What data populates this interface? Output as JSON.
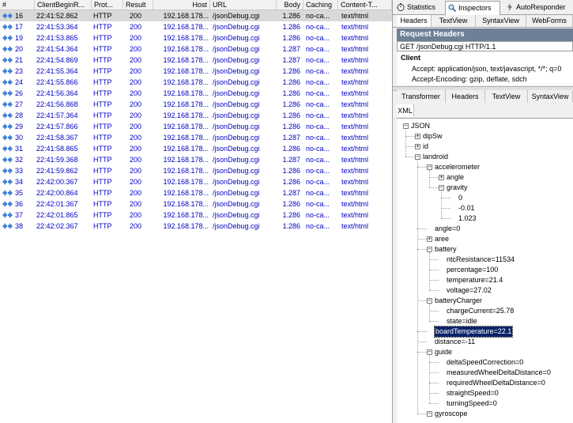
{
  "session_list": {
    "columns": [
      "#",
      "ClientBeginR...",
      "Prot...",
      "Result",
      "Host",
      "URL",
      "Body",
      "Caching",
      "Content-T..."
    ],
    "rows": [
      {
        "num": "16",
        "time": "22:41:52.862",
        "protocol": "HTTP",
        "result": "200",
        "host": "192.168.178...",
        "url": "/jsonDebug.cgi",
        "body": "1.286",
        "caching": "no-ca...",
        "ctype": "text/html",
        "selected": true
      },
      {
        "num": "17",
        "time": "22:41:53.364",
        "protocol": "HTTP",
        "result": "200",
        "host": "192.168.178...",
        "url": "/jsonDebug.cgi",
        "body": "1.286",
        "caching": "no-ca...",
        "ctype": "text/html"
      },
      {
        "num": "19",
        "time": "22:41:53.865",
        "protocol": "HTTP",
        "result": "200",
        "host": "192.168.178...",
        "url": "/jsonDebug.cgi",
        "body": "1.286",
        "caching": "no-ca...",
        "ctype": "text/html"
      },
      {
        "num": "20",
        "time": "22:41:54.364",
        "protocol": "HTTP",
        "result": "200",
        "host": "192.168.178...",
        "url": "/jsonDebug.cgi",
        "body": "1.287",
        "caching": "no-ca...",
        "ctype": "text/html"
      },
      {
        "num": "21",
        "time": "22:41:54.869",
        "protocol": "HTTP",
        "result": "200",
        "host": "192.168.178...",
        "url": "/jsonDebug.cgi",
        "body": "1.287",
        "caching": "no-ca...",
        "ctype": "text/html"
      },
      {
        "num": "23",
        "time": "22:41:55.364",
        "protocol": "HTTP",
        "result": "200",
        "host": "192.168.178...",
        "url": "/jsonDebug.cgi",
        "body": "1.286",
        "caching": "no-ca...",
        "ctype": "text/html"
      },
      {
        "num": "24",
        "time": "22:41:55.866",
        "protocol": "HTTP",
        "result": "200",
        "host": "192.168.178...",
        "url": "/jsonDebug.cgi",
        "body": "1.286",
        "caching": "no-ca...",
        "ctype": "text/html"
      },
      {
        "num": "26",
        "time": "22:41:56.364",
        "protocol": "HTTP",
        "result": "200",
        "host": "192.168.178...",
        "url": "/jsonDebug.cgi",
        "body": "1.286",
        "caching": "no-ca...",
        "ctype": "text/html"
      },
      {
        "num": "27",
        "time": "22:41:56.868",
        "protocol": "HTTP",
        "result": "200",
        "host": "192.168.178...",
        "url": "/jsonDebug.cgi",
        "body": "1.286",
        "caching": "no-ca...",
        "ctype": "text/html"
      },
      {
        "num": "28",
        "time": "22:41:57.364",
        "protocol": "HTTP",
        "result": "200",
        "host": "192.168.178...",
        "url": "/jsonDebug.cgi",
        "body": "1.286",
        "caching": "no-ca...",
        "ctype": "text/html"
      },
      {
        "num": "29",
        "time": "22:41:57.866",
        "protocol": "HTTP",
        "result": "200",
        "host": "192.168.178...",
        "url": "/jsonDebug.cgi",
        "body": "1.286",
        "caching": "no-ca...",
        "ctype": "text/html"
      },
      {
        "num": "30",
        "time": "22:41:58.367",
        "protocol": "HTTP",
        "result": "200",
        "host": "192.168.178...",
        "url": "/jsonDebug.cgi",
        "body": "1.287",
        "caching": "no-ca...",
        "ctype": "text/html"
      },
      {
        "num": "31",
        "time": "22:41:58.865",
        "protocol": "HTTP",
        "result": "200",
        "host": "192.168.178...",
        "url": "/jsonDebug.cgi",
        "body": "1.286",
        "caching": "no-ca...",
        "ctype": "text/html"
      },
      {
        "num": "32",
        "time": "22:41:59.368",
        "protocol": "HTTP",
        "result": "200",
        "host": "192.168.178...",
        "url": "/jsonDebug.cgi",
        "body": "1.287",
        "caching": "no-ca...",
        "ctype": "text/html"
      },
      {
        "num": "33",
        "time": "22:41:59.862",
        "protocol": "HTTP",
        "result": "200",
        "host": "192.168.178...",
        "url": "/jsonDebug.cgi",
        "body": "1.286",
        "caching": "no-ca...",
        "ctype": "text/html"
      },
      {
        "num": "34",
        "time": "22:42:00.367",
        "protocol": "HTTP",
        "result": "200",
        "host": "192.168.178...",
        "url": "/jsonDebug.cgi",
        "body": "1.286",
        "caching": "no-ca...",
        "ctype": "text/html"
      },
      {
        "num": "35",
        "time": "22:42:00.864",
        "protocol": "HTTP",
        "result": "200",
        "host": "192.168.178...",
        "url": "/jsonDebug.cgi",
        "body": "1.287",
        "caching": "no-ca...",
        "ctype": "text/html"
      },
      {
        "num": "36",
        "time": "22:42:01.367",
        "protocol": "HTTP",
        "result": "200",
        "host": "192.168.178...",
        "url": "/jsonDebug.cgi",
        "body": "1.286",
        "caching": "no-ca...",
        "ctype": "text/html"
      },
      {
        "num": "37",
        "time": "22:42:01.865",
        "protocol": "HTTP",
        "result": "200",
        "host": "192.168.178...",
        "url": "/jsonDebug.cgi",
        "body": "1.286",
        "caching": "no-ca...",
        "ctype": "text/html"
      },
      {
        "num": "38",
        "time": "22:42:02.367",
        "protocol": "HTTP",
        "result": "200",
        "host": "192.168.178...",
        "url": "/jsonDebug.cgi",
        "body": "1.286",
        "caching": "no-ca...",
        "ctype": "text/html"
      }
    ]
  },
  "inspector": {
    "main_tabs": [
      "Statistics",
      "Inspectors",
      "AutoResponder"
    ],
    "request_tabs": [
      "Headers",
      "TextView",
      "SyntaxView",
      "WebForms"
    ],
    "request_headers": {
      "title": "Request Headers",
      "request_line": "GET /jsonDebug.cgi HTTP/1.1",
      "group": "Client",
      "headers": [
        "Accept: application/json, text/javascript, */*; q=0",
        "Accept-Encoding: gzip, deflate, sdch"
      ]
    },
    "response_tabs": [
      "Transformer",
      "Headers",
      "TextView",
      "SyntaxView",
      "XML"
    ],
    "tree": [
      {
        "label": "JSON",
        "level": 0,
        "exp": "-"
      },
      {
        "label": "dipSw",
        "level": 1,
        "exp": "+"
      },
      {
        "label": "id",
        "level": 1,
        "exp": "+"
      },
      {
        "label": "landroid",
        "level": 1,
        "exp": "-"
      },
      {
        "label": "accelerometer",
        "level": 2,
        "exp": "-"
      },
      {
        "label": "angle",
        "level": 3,
        "exp": "+"
      },
      {
        "label": "gravity",
        "level": 3,
        "exp": "-"
      },
      {
        "label": "0",
        "level": 4,
        "exp": ""
      },
      {
        "label": "-0.01",
        "level": 4,
        "exp": ""
      },
      {
        "label": "1.023",
        "level": 4,
        "exp": ""
      },
      {
        "label": "angle=0",
        "level": 2,
        "exp": ""
      },
      {
        "label": "aree",
        "level": 2,
        "exp": "+"
      },
      {
        "label": "battery",
        "level": 2,
        "exp": "-"
      },
      {
        "label": "ntcResistance=11534",
        "level": 3,
        "exp": ""
      },
      {
        "label": "percentage=100",
        "level": 3,
        "exp": ""
      },
      {
        "label": "temperature=21.4",
        "level": 3,
        "exp": ""
      },
      {
        "label": "voltage=27.02",
        "level": 3,
        "exp": ""
      },
      {
        "label": "batteryCharger",
        "level": 2,
        "exp": "-"
      },
      {
        "label": "chargeCurrent=25.78",
        "level": 3,
        "exp": ""
      },
      {
        "label": "state=idle",
        "level": 3,
        "exp": ""
      },
      {
        "label": "boardTemperature=22.1",
        "level": 2,
        "exp": "",
        "selected": true
      },
      {
        "label": "distance=-11",
        "level": 2,
        "exp": ""
      },
      {
        "label": "guide",
        "level": 2,
        "exp": "-"
      },
      {
        "label": "deltaSpeedCorrection=0",
        "level": 3,
        "exp": ""
      },
      {
        "label": "measuredWheelDeltaDistance=0",
        "level": 3,
        "exp": ""
      },
      {
        "label": "requiredWheelDeltaDistance=0",
        "level": 3,
        "exp": ""
      },
      {
        "label": "straightSpeed=0",
        "level": 3,
        "exp": ""
      },
      {
        "label": "turningSpeed=0",
        "level": 3,
        "exp": ""
      },
      {
        "label": "gyroscope",
        "level": 2,
        "exp": "-"
      }
    ]
  },
  "colors": {
    "link_text": "#0000c8",
    "selected_row": "#d9d9d9",
    "header_band": "#6e8096",
    "tree_selection": "#0a246a"
  }
}
